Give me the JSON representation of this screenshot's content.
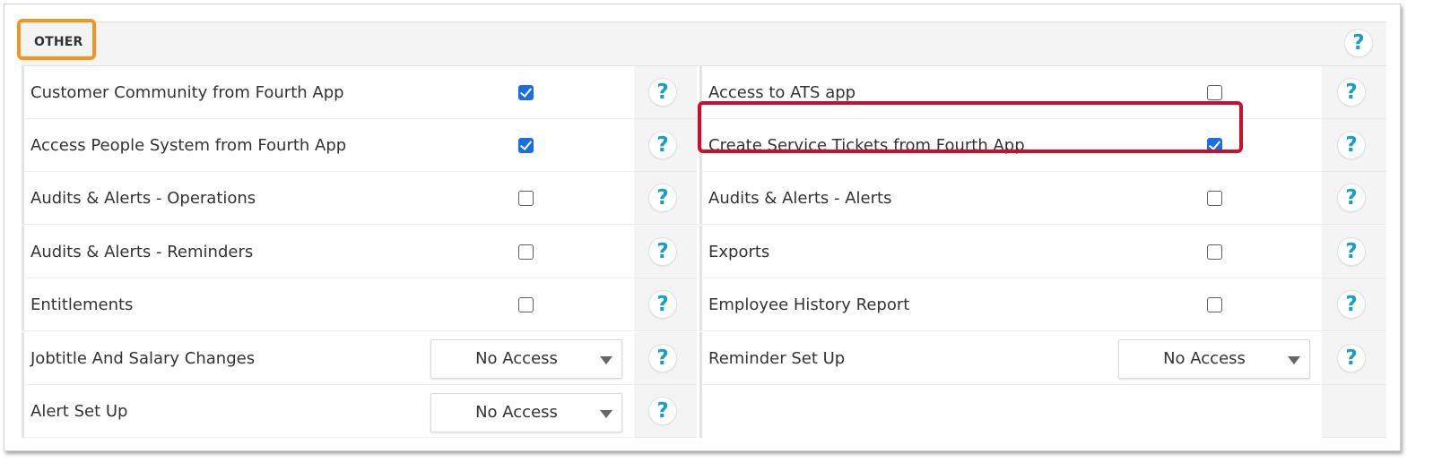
{
  "section": {
    "title": "OTHER",
    "help_glyph": "?"
  },
  "rows": [
    {
      "left": {
        "label": "Customer Community from Fourth App",
        "control": "checkbox",
        "checked": true
      },
      "right": {
        "label": "Access to ATS app",
        "control": "checkbox",
        "checked": false
      }
    },
    {
      "left": {
        "label": "Access People System from Fourth App",
        "control": "checkbox",
        "checked": true
      },
      "right": {
        "label": "Create Service Tickets from Fourth App",
        "control": "checkbox",
        "checked": true
      }
    },
    {
      "left": {
        "label": "Audits & Alerts - Operations",
        "control": "checkbox",
        "checked": false
      },
      "right": {
        "label": "Audits & Alerts - Alerts",
        "control": "checkbox",
        "checked": false
      }
    },
    {
      "left": {
        "label": "Audits & Alerts - Reminders",
        "control": "checkbox",
        "checked": false
      },
      "right": {
        "label": "Exports",
        "control": "checkbox",
        "checked": false
      }
    },
    {
      "left": {
        "label": "Entitlements",
        "control": "checkbox",
        "checked": false
      },
      "right": {
        "label": "Employee History Report",
        "control": "checkbox",
        "checked": false
      }
    },
    {
      "left": {
        "label": "Jobtitle And Salary Changes",
        "control": "select",
        "value": "No Access"
      },
      "right": {
        "label": "Reminder Set Up",
        "control": "select",
        "value": "No Access"
      }
    },
    {
      "left": {
        "label": "Alert Set Up",
        "control": "select",
        "value": "No Access"
      },
      "right": null
    }
  ],
  "icons": {
    "help": "question-mark-icon",
    "dropdown": "triangle-down-icon"
  },
  "colors": {
    "accent_blue": "#1a6fe0",
    "help_teal": "#1a9fc4",
    "highlight_orange": "#f7941d",
    "highlight_red": "#c8102e"
  }
}
